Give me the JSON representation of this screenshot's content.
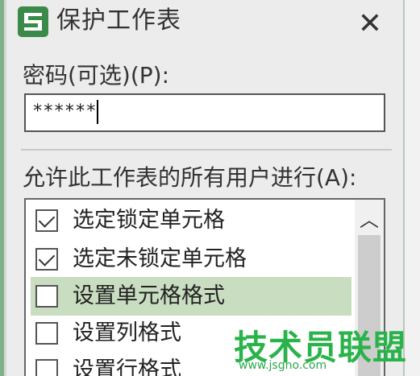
{
  "window": {
    "title": "保护工作表",
    "app_icon": "wps-spreadsheet-icon",
    "close_glyph": "✕"
  },
  "password": {
    "label": "密码(可选)(P):",
    "value": "******"
  },
  "permissions": {
    "label": "允许此工作表的所有用户进行(A):",
    "items": [
      {
        "label": "选定锁定单元格",
        "checked": true,
        "selected": false
      },
      {
        "label": "选定未锁定单元格",
        "checked": true,
        "selected": false
      },
      {
        "label": "设置单元格格式",
        "checked": false,
        "selected": true
      },
      {
        "label": "设置列格式",
        "checked": false,
        "selected": false
      },
      {
        "label": "设置行格式",
        "checked": false,
        "selected": false
      }
    ],
    "scroll_up_glyph": "︿"
  },
  "watermark": {
    "text": "技术员联盟",
    "url": "www.jsgho.com"
  },
  "colors": {
    "selected_row": "#c9ddc0",
    "app_icon": "#3a8a4a",
    "watermark": "#29b34a"
  }
}
